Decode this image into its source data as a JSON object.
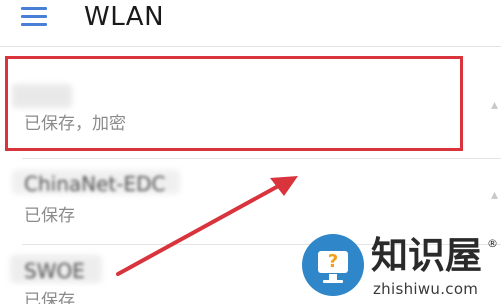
{
  "header": {
    "title": "WLAN",
    "menu_icon": "hamburger-menu-icon"
  },
  "networks": [
    {
      "ssid": "D",
      "ssid_obscured": true,
      "status": "已保存，加密",
      "highlighted": true
    },
    {
      "ssid": "ChinaNet-EDC",
      "ssid_obscured": true,
      "status": "已保存",
      "highlighted": false
    },
    {
      "ssid": "SWOE",
      "ssid_obscured": true,
      "status": "已保存",
      "highlighted": false
    }
  ],
  "annotation": {
    "highlight_color": "#d9333b",
    "arrow_color": "#d9333b"
  },
  "watermark": {
    "logo_icon": "monitor-question-icon",
    "logo_glyph": "?",
    "title": "知识屋",
    "registered": "®",
    "url": "zhishiwu.com",
    "logo_color": "#2f86c8"
  },
  "colors": {
    "accent": "#4a7fd8",
    "text_primary": "#1f1f1f",
    "text_secondary": "#8b8b8b",
    "divider": "#e4e4e4"
  }
}
